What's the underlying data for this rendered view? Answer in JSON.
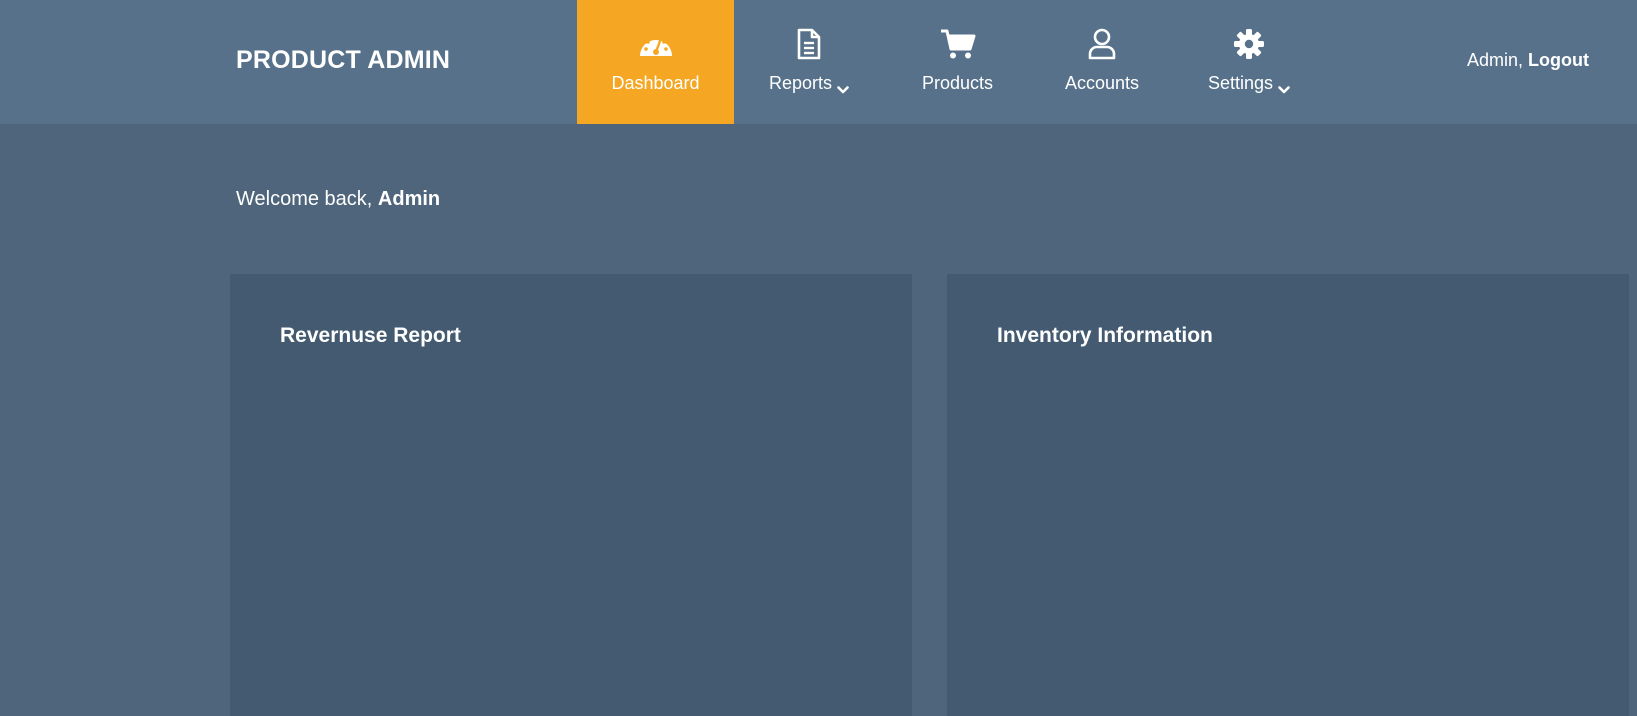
{
  "header": {
    "brand": "PRODUCT ADMIN",
    "nav": [
      {
        "label": "Dashboard",
        "icon": "gauge-icon",
        "active": true,
        "dropdown": false
      },
      {
        "label": "Reports",
        "icon": "file-icon",
        "active": false,
        "dropdown": true
      },
      {
        "label": "Products",
        "icon": "cart-icon",
        "active": false,
        "dropdown": false
      },
      {
        "label": "Accounts",
        "icon": "user-icon",
        "active": false,
        "dropdown": false
      },
      {
        "label": "Settings",
        "icon": "gear-icon",
        "active": false,
        "dropdown": true
      }
    ],
    "user": {
      "name": "Admin,",
      "logout": "Logout"
    }
  },
  "main": {
    "welcome_prefix": "Welcome back,",
    "welcome_name": "Admin",
    "panels": [
      {
        "title": "Revernuse Report"
      },
      {
        "title": "Inventory Information"
      }
    ]
  },
  "colors": {
    "page_bg": "#4e657b",
    "header_bg": "#567189",
    "active_nav": "#f5a623",
    "panel_bg": "#435a70",
    "text": "#ffffff"
  }
}
